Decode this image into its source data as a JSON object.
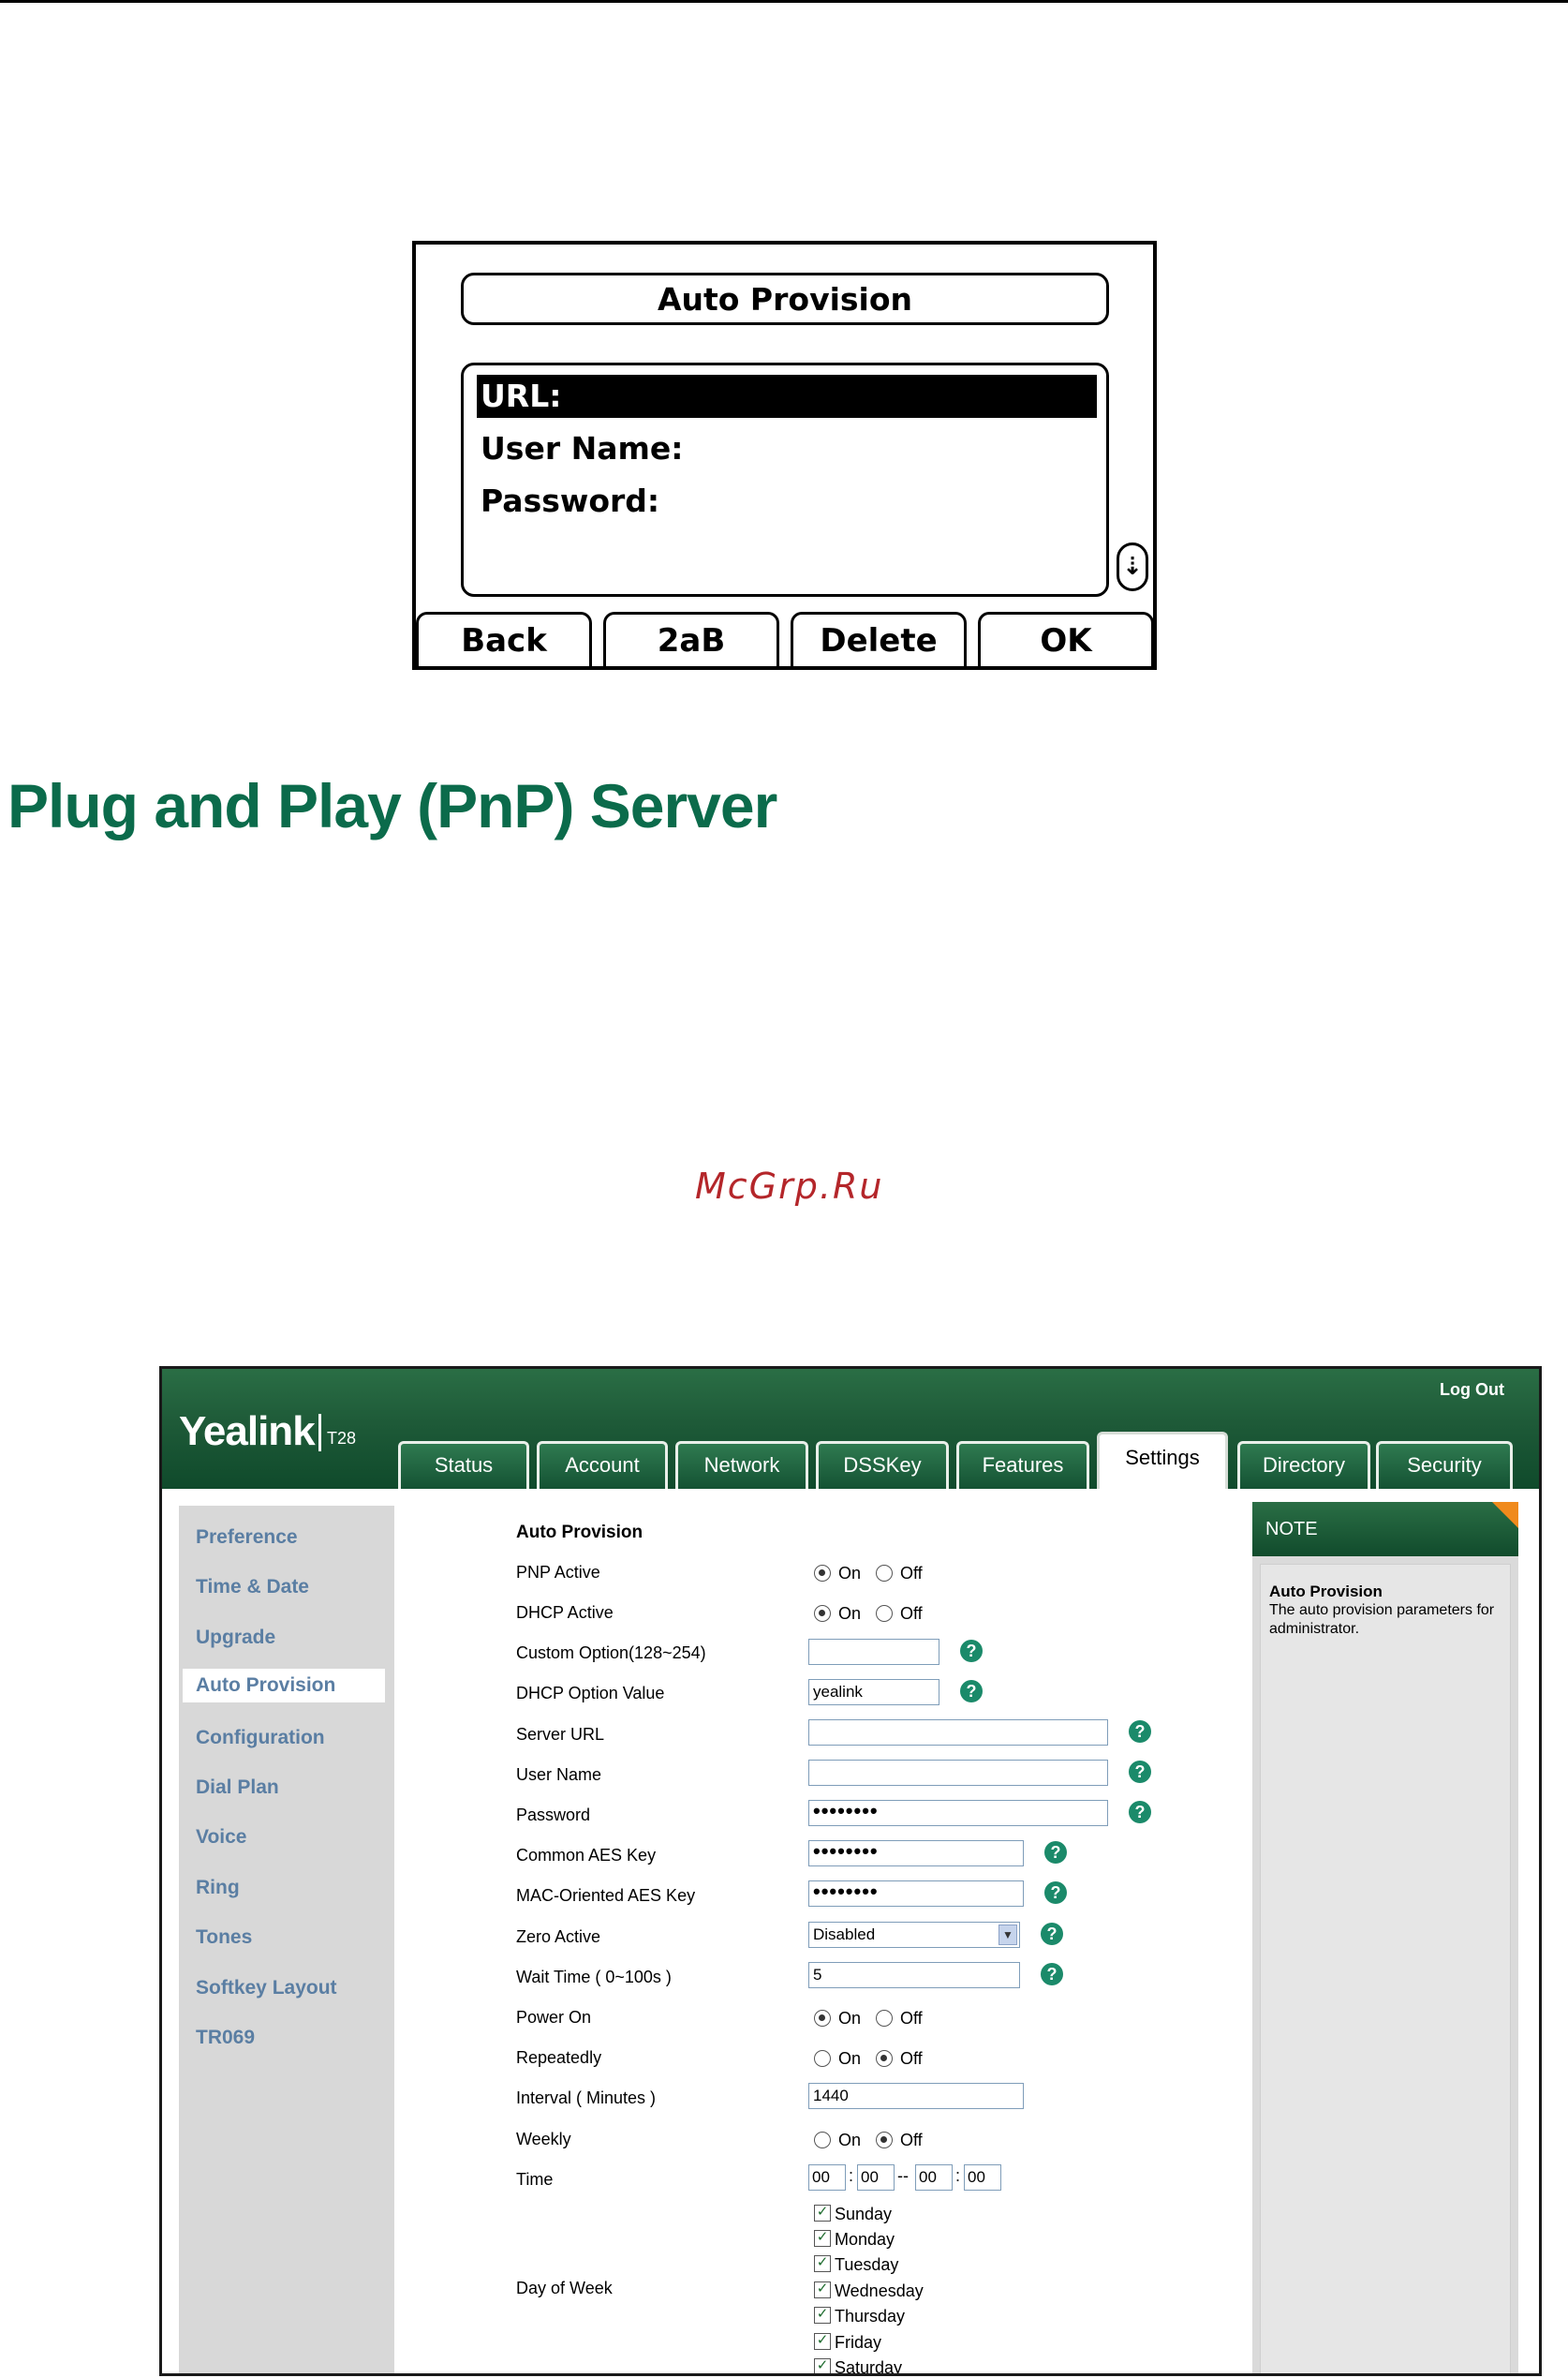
{
  "phone": {
    "title": "Auto Provision",
    "lines": [
      "URL:",
      "User Name:",
      "Password:"
    ],
    "scroll_icon": "scroll-down-icon",
    "softkeys": [
      "Back",
      "2aB",
      "Delete",
      "OK"
    ]
  },
  "heading": "Plug and Play (PnP) Server",
  "watermark": "McGrp.Ru",
  "web": {
    "logo": "Yealink",
    "model": "T28",
    "logout": "Log Out",
    "tabs": [
      "Status",
      "Account",
      "Network",
      "DSSKey",
      "Features",
      "Settings",
      "Directory",
      "Security"
    ],
    "active_tab": "Settings",
    "sidebar": [
      "Preference",
      "Time & Date",
      "Upgrade",
      "Auto Provision",
      "Configuration",
      "Dial Plan",
      "Voice",
      "Ring",
      "Tones",
      "Softkey Layout",
      "TR069"
    ],
    "active_sidebar": "Auto Provision",
    "section_title": "Auto Provision",
    "fields": {
      "pnp_active": {
        "label": "PNP Active",
        "value": "On"
      },
      "dhcp_active": {
        "label": "DHCP Active",
        "value": "On"
      },
      "custom_option": {
        "label": "Custom Option(128~254)",
        "value": ""
      },
      "dhcp_option_value": {
        "label": "DHCP Option Value",
        "value": "yealink"
      },
      "server_url": {
        "label": "Server URL",
        "value": ""
      },
      "user_name": {
        "label": "User Name",
        "value": ""
      },
      "password": {
        "label": "Password",
        "value": "••••••••"
      },
      "common_aes_key": {
        "label": "Common AES Key",
        "value": "••••••••"
      },
      "mac_aes_key": {
        "label": "MAC-Oriented AES Key",
        "value": "••••••••"
      },
      "zero_active": {
        "label": "Zero Active",
        "value": "Disabled"
      },
      "wait_time": {
        "label": "Wait Time ( 0~100s )",
        "value": "5"
      },
      "power_on": {
        "label": "Power On",
        "value": "On"
      },
      "repeatedly": {
        "label": "Repeatedly",
        "value": "Off"
      },
      "interval": {
        "label": "Interval ( Minutes )",
        "value": "1440"
      },
      "weekly": {
        "label": "Weekly",
        "value": "Off"
      },
      "time": {
        "label": "Time",
        "values": [
          "00",
          "00",
          "00",
          "00"
        ],
        "sep1": ":",
        "sep2": "--",
        "sep3": ":"
      },
      "day_of_week": {
        "label": "Day of Week",
        "days": [
          "Sunday",
          "Monday",
          "Tuesday",
          "Wednesday",
          "Thursday",
          "Friday",
          "Saturday"
        ],
        "checked": [
          true,
          true,
          true,
          true,
          true,
          true,
          true
        ]
      }
    },
    "radio_on": "On",
    "radio_off": "Off",
    "note": {
      "head": "NOTE",
      "title": "Auto Provision",
      "text": "The auto provision parameters for administrator."
    },
    "help_glyph": "?",
    "check_glyph": "✓",
    "select_arrow": "▼"
  }
}
